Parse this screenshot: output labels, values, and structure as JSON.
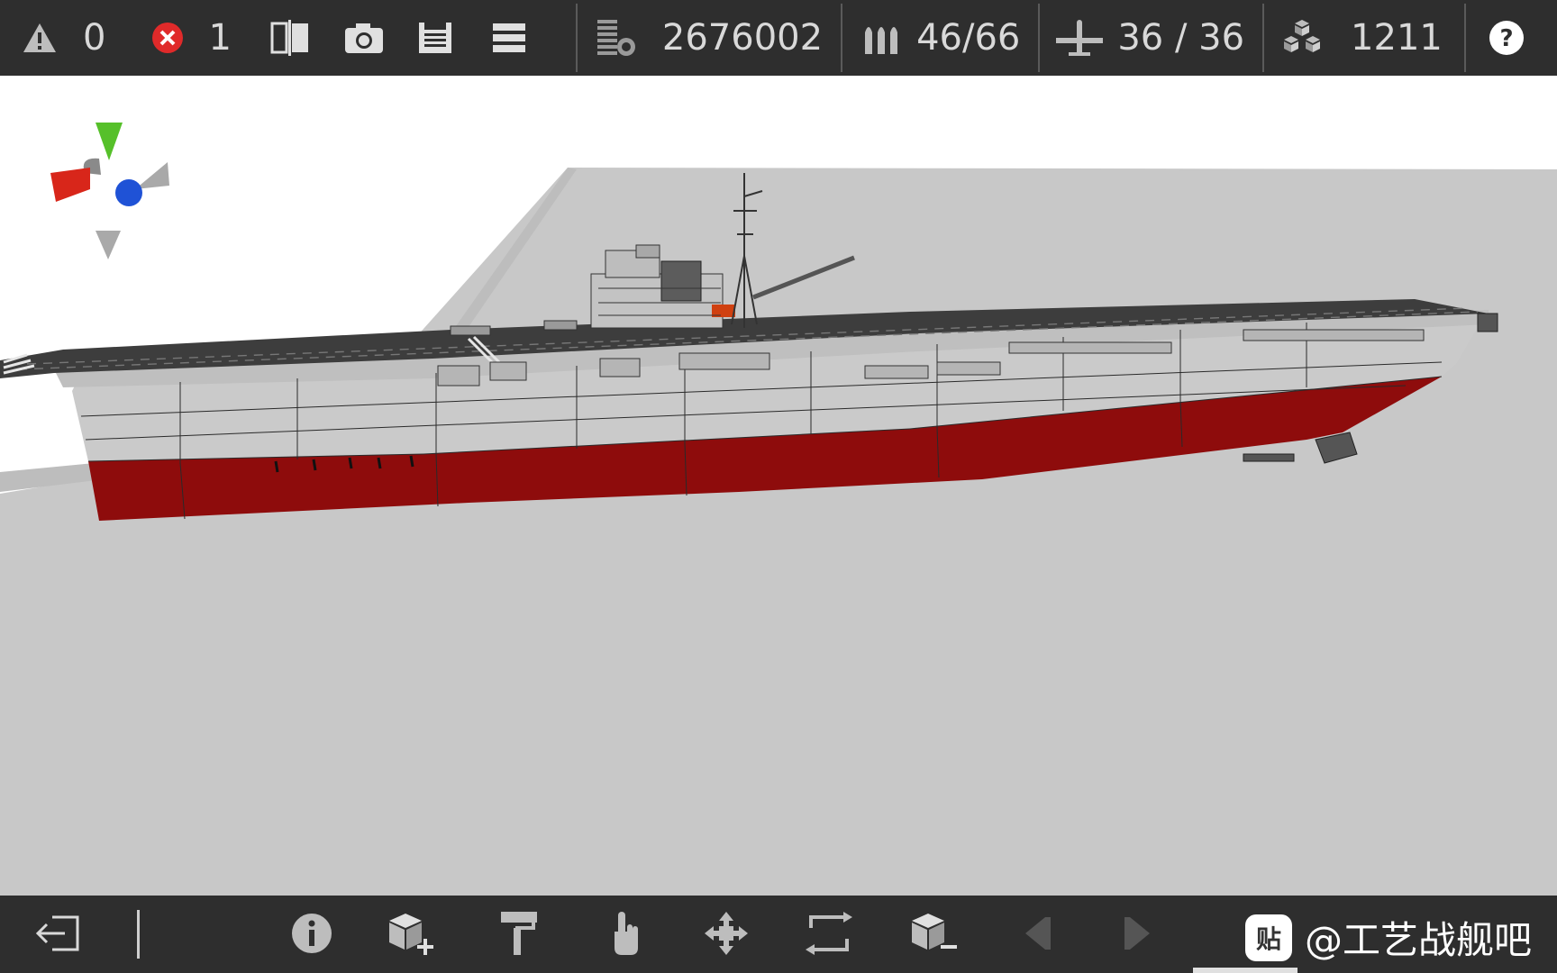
{
  "toolbar": {
    "warnings_count": "0",
    "errors_count": "1",
    "cost": "2676002",
    "weapons": "46/66",
    "aircraft": "36 / 36",
    "parts": "1211",
    "icons": [
      "warning-icon",
      "error-icon",
      "mirror-icon",
      "camera-icon",
      "save-icon",
      "menu-icon",
      "cost-icon",
      "ammo-icon",
      "aircraft-icon",
      "parts-icon",
      "help-icon"
    ]
  },
  "colors": {
    "bar_bg": "#2e2e2e",
    "hull_red": "#8e0c0c",
    "hull_gray": "#c9c9c9",
    "deck_dark": "#3d3d3d",
    "axis_x": "#d8261a",
    "axis_y": "#4fbf1e",
    "axis_z": "#1f52d6"
  },
  "bottom_toolbar": {
    "icons": [
      "exit-icon",
      "info-icon",
      "add-part-icon",
      "paint-roller-icon",
      "hand-pointer-icon",
      "move-icon",
      "rotate-icon",
      "remove-part-icon",
      "prev-icon",
      "next-icon"
    ]
  },
  "watermark": {
    "logo_text": "贴",
    "text": "@工艺战舰吧"
  }
}
